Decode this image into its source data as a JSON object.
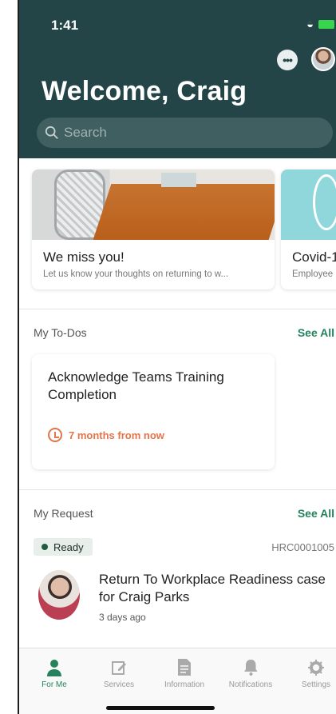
{
  "status_bar": {
    "time": "1:41"
  },
  "header": {
    "title": "Welcome, Craig"
  },
  "search": {
    "placeholder": "Search"
  },
  "cards": [
    {
      "title": "We miss you!",
      "subtitle": "Let us know your thoughts on returning to w..."
    },
    {
      "title": "Covid-1",
      "subtitle": "Employee"
    }
  ],
  "todos": {
    "section_title": "My To-Dos",
    "see_all": "See All",
    "item": {
      "title": "Acknowledge Teams Training Completion",
      "due": "7 months from now"
    }
  },
  "requests": {
    "section_title": "My Request",
    "see_all": "See All",
    "status": "Ready",
    "number": "HRC0001005",
    "title": "Return To Workplace Readiness case for Craig Parks",
    "time": "3 days ago"
  },
  "tabs": [
    "For Me",
    "Services",
    "Information",
    "Notifications",
    "Settings"
  ],
  "colors": {
    "header": "#234548",
    "accent": "#24835c",
    "due": "#e4744a"
  }
}
